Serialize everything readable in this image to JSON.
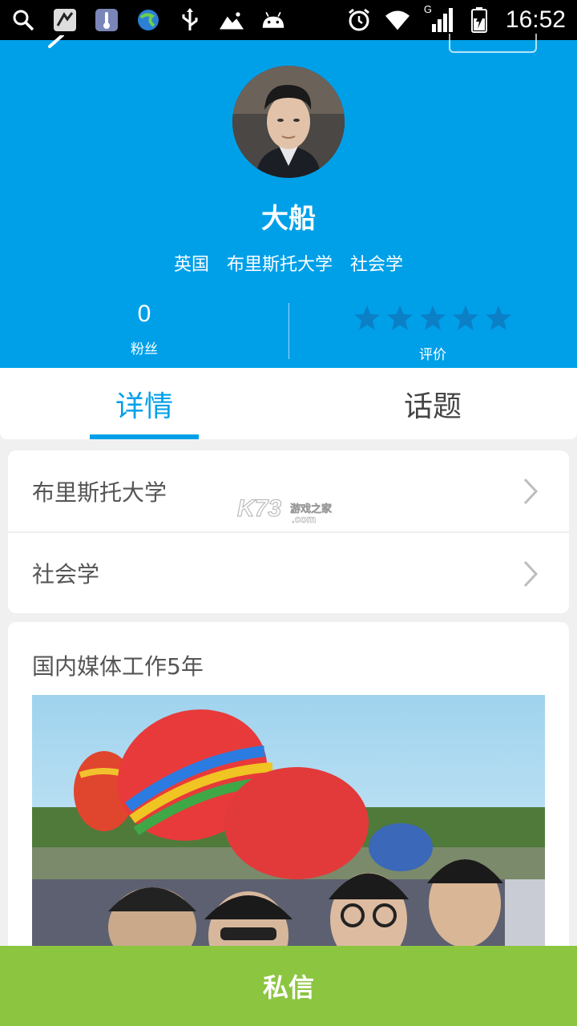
{
  "status_bar": {
    "time": "16:52",
    "icons": [
      "search-icon",
      "app-icon",
      "thermometer-icon",
      "browser-icon",
      "usb-icon",
      "image-icon",
      "android-icon",
      "alarm-icon",
      "wifi-icon",
      "signal-icon",
      "battery-icon"
    ],
    "network_label": "G"
  },
  "profile": {
    "name": "大船",
    "country": "英国",
    "university": "布里斯托大学",
    "major": "社会学",
    "fans_count": "0",
    "fans_label": "粉丝",
    "rating_label": "评价",
    "rating_stars": 0,
    "rating_max": 5
  },
  "tabs": [
    {
      "label": "详情",
      "active": true
    },
    {
      "label": "话题",
      "active": false
    }
  ],
  "info_rows": [
    {
      "label": "布里斯托大学"
    },
    {
      "label": "社会学"
    }
  ],
  "bio": {
    "text": "国内媒体工作5年"
  },
  "watermark": {
    "main": "K73",
    "sub": "游戏之家",
    "domain": ".com"
  },
  "bottom_bar": {
    "label": "私信"
  },
  "colors": {
    "header_blue": "#00a0e9",
    "star_color": "#0b80c6",
    "bottom_green": "#8cc540"
  }
}
